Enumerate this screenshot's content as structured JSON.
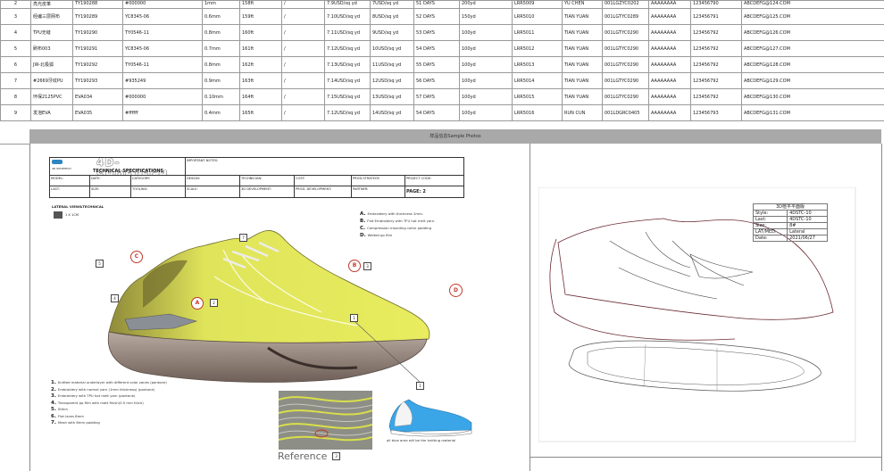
{
  "table": {
    "rows": [
      {
        "no": "2",
        "name": "亮光皮革",
        "code": "TY190288",
        "color": "#000000",
        "thick": "1mm",
        "width": "158ft",
        "sep": "/",
        "price": "7.9USD/sq yd",
        "price2": "7USD/sq yd",
        "lead": "51 DAYS",
        "moq": "200yd",
        "ref": "LRR5009",
        "contact": "YU CHEN",
        "phone": "001LGZYC0202",
        "pass": "AAAAAAAA",
        "tel": "123456790",
        "email": "ABCDEFG@124.COM"
      },
      {
        "no": "3",
        "name": "经编三层网布",
        "code": "TY190289",
        "color": "YC8345-06",
        "thick": "0.6mm",
        "width": "159ft",
        "sep": "/",
        "price": "7.10USD/sq yd",
        "price2": "8USD/sq yd",
        "lead": "52 DAYS",
        "moq": "150yd",
        "ref": "LRR5010",
        "contact": "TIAN YUAN",
        "phone": "001LGTYC0289",
        "pass": "AAAAAAAA",
        "tel": "123456791",
        "email": "ABCDEFG@125.COM"
      },
      {
        "no": "4",
        "name": "TPU无缝",
        "code": "TY190290",
        "color": "TY0546-11",
        "thick": "0.8mm",
        "width": "160ft",
        "sep": "/",
        "price": "7.11USD/sq yd",
        "price2": "9USD/sq yd",
        "lead": "53 DAYS",
        "moq": "100yd",
        "ref": "LRR5011",
        "contact": "TIAN YUAN",
        "phone": "001LGTYC0290",
        "pass": "AAAAAAAA",
        "tel": "123456792",
        "email": "ABCDEFG@126.COM"
      },
      {
        "no": "5",
        "name": "刷布003",
        "code": "TY190291",
        "color": "YC8345-06",
        "thick": "0.7mm",
        "width": "161ft",
        "sep": "/",
        "price": "7.12USD/sq yd",
        "price2": "10USD/sq yd",
        "lead": "54 DAYS",
        "moq": "100yd",
        "ref": "LRR5012",
        "contact": "TIAN YUAN",
        "phone": "001LGTYC0290",
        "pass": "AAAAAAAA",
        "tel": "123456792",
        "email": "ABCDEFG@127.COM"
      },
      {
        "no": "6",
        "name": "JW-北极狐",
        "code": "TY190292",
        "color": "TY0546-11",
        "thick": "0.8mm",
        "width": "162ft",
        "sep": "/",
        "price": "7.13USD/sq yd",
        "price2": "11USD/sq yd",
        "lead": "55 DAYS",
        "moq": "100yd",
        "ref": "LRR5013",
        "contact": "TIAN YUAN",
        "phone": "001LGTYC0290",
        "pass": "AAAAAAAA",
        "tel": "123456792",
        "email": "ABCDEFG@128.COM"
      },
      {
        "no": "7",
        "name": "#2669牙纹PU",
        "code": "TY190293",
        "color": "#935249",
        "thick": "0.9mm",
        "width": "163ft",
        "sep": "/",
        "price": "7.14USD/sq yd",
        "price2": "12USD/sq yd",
        "lead": "56 DAYS",
        "moq": "100yd",
        "ref": "LRR5014",
        "contact": "TIAN YUAN",
        "phone": "001LGTYC0290",
        "pass": "AAAAAAAA",
        "tel": "123456792",
        "email": "ABCDEFG@129.COM"
      },
      {
        "no": "8",
        "name": "环保2125PVC",
        "code": "EVA034",
        "color": "#000000",
        "thick": "0.10mm",
        "width": "164ft",
        "sep": "/",
        "price": "7.15USD/sq yd",
        "price2": "13USD/sq yd",
        "lead": "57 DAYS",
        "moq": "100yd",
        "ref": "LRR5015",
        "contact": "TIAN YUAN",
        "phone": "001LGTYC0290",
        "pass": "AAAAAAAA",
        "tel": "123456792",
        "email": "ABCDEFG@130.COM"
      },
      {
        "no": "9",
        "name": "发泡EVA",
        "code": "EVA035",
        "color": "#ffffff",
        "thick": "0.4mm",
        "width": "165ft",
        "sep": "/",
        "price": "7.12USD/sq yd",
        "price2": "14USD/sq yd",
        "lead": "54 DAYS",
        "moq": "100yd",
        "ref": "LRR5016",
        "contact": "RUN CUN",
        "phone": "001LDGRC0405",
        "pass": "AAAAAAAA",
        "tel": "123456793",
        "email": "ABCDEFG@131.COM"
      }
    ]
  },
  "banner": "样品信息Sample Photos",
  "spec": {
    "brand": "4D-SHOETECH",
    "logo_text": "4D SHOETECH",
    "title": "TECHNICAL SPECIFICATIONS",
    "important_notes": "IMPORTANT NOTES:",
    "model": "MODEL:",
    "date": "DATE:",
    "category": "CATEGORY:",
    "design": "DESIGN:",
    "technician": "TECHNICIAN:",
    "cost": "COST:",
    "prod_strategy": "PROD.STRATEGY:",
    "project_code": "PROJECT CODE:",
    "last": "LAST:",
    "size": "SIZE:",
    "tooling": "TOOLING:",
    "scale": "SCALE:",
    "dev3d": "3D DEVELOPMENT:",
    "prod_dev": "PROD. DEVELOPMENT:",
    "partner": "PARTNER:",
    "page": "PAGE: 2"
  },
  "lateral": {
    "title": "LATERAL VIEW&TECHNICAL",
    "scale": "1 X 1CM"
  },
  "abcd": [
    {
      "k": "A.",
      "t": "Embroidery with thickness 2mm."
    },
    {
      "k": "B.",
      "t": "Flat Embroidery with TFU hot melt yarn."
    },
    {
      "k": "C.",
      "t": "Compression moulding collar padding"
    },
    {
      "k": "D.",
      "t": "Welted pp film"
    }
  ],
  "notes": [
    {
      "k": "1.",
      "t": "Knitted material underlayer with different color zones (pantone)"
    },
    {
      "k": "2.",
      "t": "Embroidery with normal yarn (1mm thickness) (pantone)"
    },
    {
      "k": "3.",
      "t": "Embroidery with TPU hot melt yarn (pantone)"
    },
    {
      "k": "4.",
      "t": "Transparent pp film with matt finish(0.5 mm thick)"
    },
    {
      "k": "5.",
      "t": "Stitch"
    },
    {
      "k": "6.",
      "t": "Flat laces 8mm"
    },
    {
      "k": "7.",
      "t": "Mesh with 6mm padding"
    }
  ],
  "callouts": {
    "a": "A",
    "b": "B",
    "c": "C",
    "d": "D",
    "n1": "1",
    "n2": "2",
    "n3": "3",
    "n4": "4",
    "n5": "5",
    "n7": "7",
    "n1b": "1"
  },
  "blue_caption": "all blue area will be the knitting material",
  "reference": "Reference",
  "reference_num": "3",
  "size_table": {
    "title": "3D楦平平面版",
    "rows": [
      {
        "k": "Style:",
        "v": "4DSTC-10"
      },
      {
        "k": "Last:",
        "v": "4DSTC-10"
      },
      {
        "k": "Size:",
        "v": "8#"
      },
      {
        "k": "LAT/MED:",
        "v": "Lateral"
      },
      {
        "k": "Date:",
        "v": "2021/06/27"
      }
    ]
  },
  "colors": {
    "yellow": "#d9df4a",
    "grey": "#a9a9a9",
    "blue": "#3aa6e8",
    "callout": "#c0392b"
  }
}
